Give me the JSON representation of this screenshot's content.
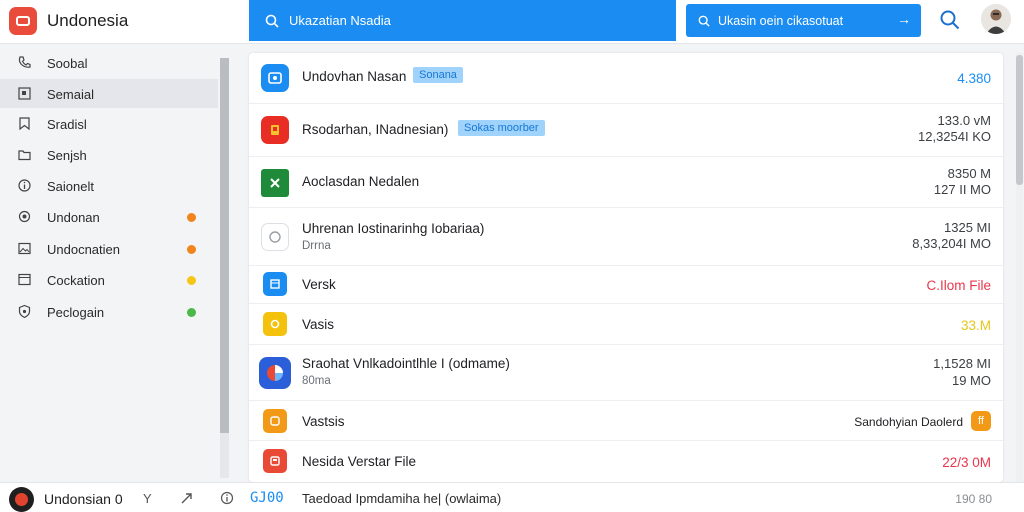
{
  "app": {
    "title": "Undonesia"
  },
  "search": {
    "placeholder": "Ukazatian Nsadia"
  },
  "action": {
    "label": "Ukasin oein cikasotuat",
    "arrow": "→"
  },
  "sidebar": {
    "items": [
      {
        "label": "Soobal",
        "icon": "phone-icon",
        "dot": null
      },
      {
        "label": "Semaial",
        "icon": "square-icon",
        "dot": null
      },
      {
        "label": "Sradisl",
        "icon": "bookmark-icon",
        "dot": null
      },
      {
        "label": "Senjsh",
        "icon": "folder-icon",
        "dot": null
      },
      {
        "label": "Saionelt",
        "icon": "info-icon",
        "dot": null
      },
      {
        "label": "Undonan",
        "icon": "circle-icon",
        "dot": "#f2841c"
      },
      {
        "label": "Undocnatien",
        "icon": "image-icon",
        "dot": "#f2841c"
      },
      {
        "label": "Cockation",
        "icon": "window-icon",
        "dot": "#f5c518"
      },
      {
        "label": "Peclogain",
        "icon": "shield-icon",
        "dot": "#4cb848"
      }
    ]
  },
  "files": [
    {
      "name": "Undovhan Nasan",
      "tag": "Sonana",
      "meta_single": "4.380",
      "meta_color": "#1a8cf2",
      "icon": "blue-app-icon",
      "icon_bg": "#1a8cf2"
    },
    {
      "name": "Rsodarhan, INadnesian)",
      "tag": "Sokas moorber",
      "meta1": "133.0 vM",
      "meta2": "12,3254I KO",
      "icon": "red-app-icon",
      "icon_bg": "#e82e24"
    },
    {
      "name": "Aoclasdan Nedalen",
      "meta1": "8350 M",
      "meta2": "127 II MO",
      "icon": "green-sheet-icon",
      "icon_bg": "#1f8a3a"
    },
    {
      "name": "Uhrenan Iostinarinhg Iobariaa)",
      "sub": "Drrna",
      "meta1": "1325 MI",
      "meta2": "8,33,204I MO",
      "icon": "white-file-icon",
      "icon_bg": "#ffffff"
    },
    {
      "name": "Versk",
      "meta_single": "C.Ilom File",
      "meta_color": "#e8374c",
      "icon": "blue-doc-icon",
      "icon_bg": "#1a8cf2"
    },
    {
      "name": "Vasis",
      "meta_single": "33.M",
      "meta_color": "#e6c61a",
      "icon": "yellow-doc-icon",
      "icon_bg": "#f4c20d"
    },
    {
      "name": "Sraohat Vnlkadointlhle I (odmame)",
      "sub": "80ma",
      "meta1": "1,1528 MI",
      "meta2": "19 MO",
      "icon": "multicolor-app-icon",
      "icon_bg": "#2b5fd9"
    },
    {
      "name": "Vastsis",
      "status_text": "Sandohyian Daolerd",
      "status_chip": "ff",
      "icon": "orange-doc-icon",
      "icon_bg": "#f29a18"
    },
    {
      "name": "Nesida Verstar File",
      "meta_single": "22/3 0M",
      "meta_color": "#e8374c",
      "icon": "red-slide-icon",
      "icon_bg": "#e84a36"
    }
  ],
  "bottom": {
    "title": "Undonsian 0",
    "y_label": "Y",
    "code": "GJ00",
    "path": "Taedoad Ipmdamiha he| (owlaima)",
    "size": "190 80"
  }
}
